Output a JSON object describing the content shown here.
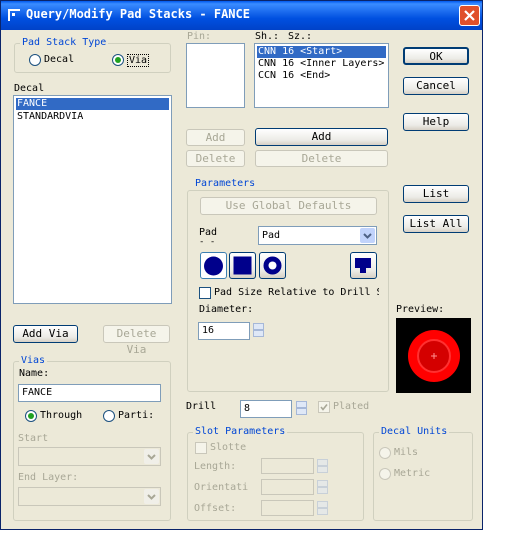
{
  "window": {
    "title": "Query/Modify Pad Stacks - FANCE"
  },
  "pad_stack_type": {
    "title": "Pad Stack Type",
    "decal_label": "Decal",
    "via_label": "Via",
    "selected": "Via"
  },
  "decal": {
    "label": "Decal",
    "items": [
      "FANCE",
      "STANDARDVIA"
    ],
    "selected": "FANCE"
  },
  "buttons": {
    "add_via": "Add Via",
    "delete_via": "Delete Via",
    "ok": "OK",
    "cancel": "Cancel",
    "help": "Help",
    "list": "List",
    "list_all": "List All",
    "add_pin": "Add",
    "delete_pin": "Delete",
    "add_shape": "Add",
    "delete_shape": "Delete",
    "global_defaults": "Use Global Defaults"
  },
  "vias": {
    "title": "Vias",
    "name_label": "Name:",
    "name_value": "FANCE",
    "through_label": "Through",
    "partial_label": "Parti:",
    "selected": "Through",
    "start_label": "Start",
    "end_layer_label": "End Layer:"
  },
  "pin": {
    "label": "Pin:"
  },
  "layers": {
    "sh_label": "Sh.:",
    "sz_label": "Sz.:",
    "items": [
      "CNN 16 <Start>",
      "CNN 16 <Inner Layers>",
      "CCN 16 <End>"
    ],
    "selected": "CNN 16 <Start>"
  },
  "parameters": {
    "title": "Parameters",
    "pad_label": "Pad",
    "pad_value": "Pad",
    "shapes": [
      "round-pad-icon",
      "square-pad-icon",
      "annular-pad-icon",
      "custom-pad-icon"
    ],
    "relative_label": "Pad Size Relative to Drill S",
    "relative_checked": false,
    "diameter_label": "Diameter:",
    "diameter_value": "16"
  },
  "preview": {
    "label": "Preview:"
  },
  "drill": {
    "label": "Drill",
    "value": "8",
    "plated_label": "Plated",
    "plated_checked": true
  },
  "slot": {
    "title": "Slot Parameters",
    "slotted_label": "Slotte",
    "length_label": "Length:",
    "orientation_label": "Orientati",
    "offset_label": "Offset:"
  },
  "decal_units": {
    "title": "Decal Units",
    "mils_label": "Mils",
    "metric_label": "Metric"
  },
  "colors": {
    "title_bar": "#0054e3",
    "selection": "#316ac5",
    "group_title": "#0046d5",
    "preview_red": "#ff0000"
  }
}
